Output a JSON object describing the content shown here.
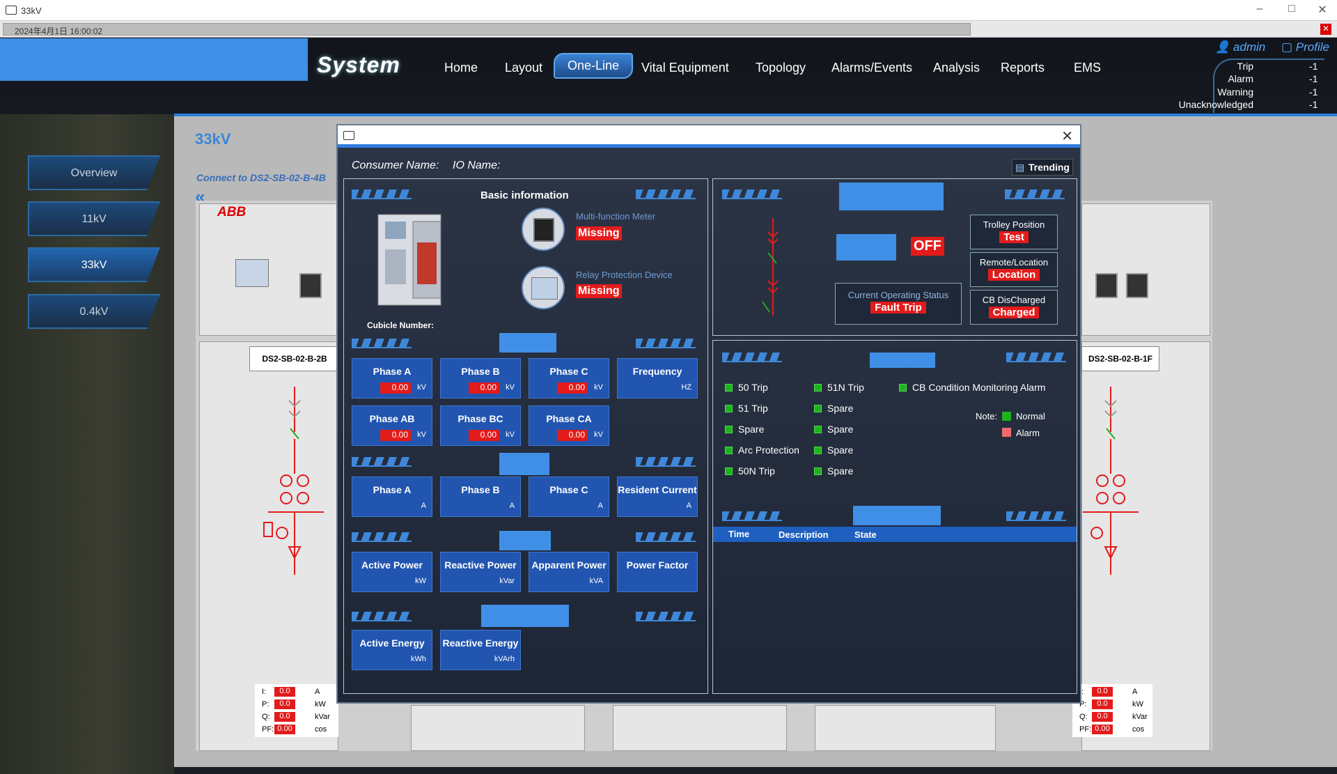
{
  "window": {
    "title": "33kV"
  },
  "datebar": {
    "datetime": "2024年4月1日 16:00:02"
  },
  "header": {
    "logo": "System",
    "nav": [
      "Home",
      "Layout",
      "One-Line",
      "Vital Equipment",
      "Topology",
      "Alarms/Events",
      "Analysis",
      "Reports",
      "EMS"
    ],
    "active_nav": "One-Line",
    "user": "admin",
    "profile": "Profile",
    "alarms": [
      {
        "label": "Trip",
        "value": "-1"
      },
      {
        "label": "Alarm",
        "value": "-1"
      },
      {
        "label": "Warning",
        "value": "-1"
      },
      {
        "label": "Unacknowledged",
        "value": "-1"
      }
    ]
  },
  "sidebar": {
    "items": [
      "Overview",
      "11kV",
      "33kV",
      "0.4kV"
    ],
    "active": "33kV"
  },
  "main": {
    "title": "33kV",
    "connect": "Connect to DS2-SB-02-B-4B",
    "brand": "ABB",
    "cabinet_left": "DS2-SB-02-B-2B",
    "cabinet_right": "DS2-SB-02-B-1F",
    "meas_labels": [
      "I:",
      "P:",
      "Q:",
      "PF:"
    ],
    "meas_values": [
      "0.0",
      "0.0",
      "0.0",
      "0.00"
    ],
    "meas_units": [
      "A",
      "kW",
      "kVar",
      "cos"
    ]
  },
  "dialog": {
    "consumer_label": "Consumer Name:",
    "io_label": "IO Name:",
    "trending": "Trending",
    "basic_info": "Basic information",
    "cubicle_label": "Cubicle Number:",
    "meter_label": "Multi-function Meter",
    "meter_status": "Missing",
    "relay_label": "Relay Protection Device",
    "relay_status": "Missing",
    "voltage_tiles": [
      {
        "name": "Phase A",
        "value": "0.00",
        "unit": "kV"
      },
      {
        "name": "Phase B",
        "value": "0.00",
        "unit": "kV"
      },
      {
        "name": "Phase C",
        "value": "0.00",
        "unit": "kV"
      },
      {
        "name": "Frequency",
        "value": "",
        "unit": "HZ"
      },
      {
        "name": "Phase AB",
        "value": "0.00",
        "unit": "kV"
      },
      {
        "name": "Phase BC",
        "value": "0.00",
        "unit": "kV"
      },
      {
        "name": "Phase CA",
        "value": "0.00",
        "unit": "kV"
      }
    ],
    "current_tiles": [
      {
        "name": "Phase A",
        "unit": "A"
      },
      {
        "name": "Phase B",
        "unit": "A"
      },
      {
        "name": "Phase C",
        "unit": "A"
      },
      {
        "name": "Resident Current",
        "unit": "A"
      }
    ],
    "power_tiles": [
      {
        "name": "Active Power",
        "unit": "kW"
      },
      {
        "name": "Reactive Power",
        "unit": "kVar"
      },
      {
        "name": "Apparent Power",
        "unit": "kVA"
      },
      {
        "name": "Power Factor",
        "unit": ""
      }
    ],
    "energy_tiles": [
      {
        "name": "Active Energy",
        "unit": "kWh"
      },
      {
        "name": "Reactive Energy",
        "unit": "kVArh"
      }
    ],
    "breaker_state": "OFF",
    "trolley": {
      "label": "Trolley Position",
      "value": "Test"
    },
    "remote": {
      "label": "Remote/Location",
      "value": "Location"
    },
    "operating": {
      "label": "Current Operating Status",
      "value": "Fault Trip"
    },
    "cb": {
      "label": "CB DisCharged",
      "value": "Charged"
    },
    "signals_col1": [
      "50 Trip",
      "51 Trip",
      "Spare",
      "Arc Protection",
      "50N Trip"
    ],
    "signals_col2": [
      "51N Trip",
      "Spare",
      "Spare",
      "Spare",
      "Spare"
    ],
    "signals_col3": [
      "CB Condition Monitoring Alarm"
    ],
    "note": {
      "label": "Note:",
      "normal": "Normal",
      "alarm": "Alarm",
      "normal_color": "#1eb31e",
      "alarm_color": "#f26b6b"
    },
    "event_columns": [
      "Time",
      "Description",
      "State"
    ]
  },
  "colors": {
    "accent": "#3f8fe6",
    "alarm_red": "#e31b1b",
    "ok_green": "#1eb31e"
  }
}
